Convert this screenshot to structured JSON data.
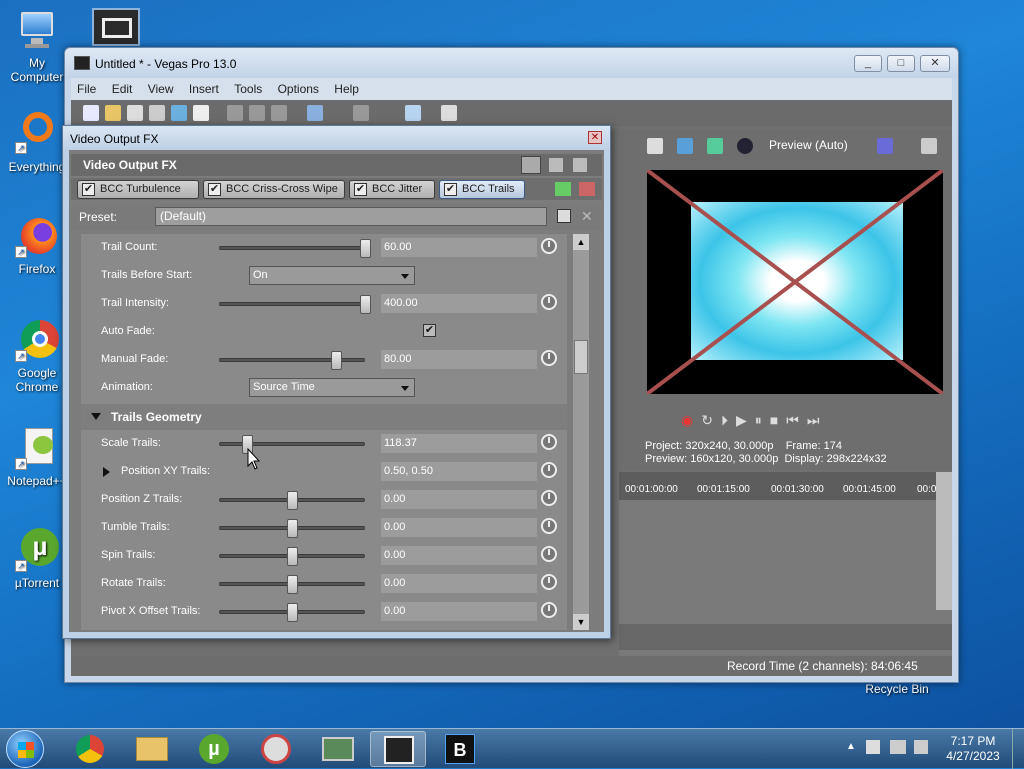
{
  "desktop": {
    "icons": [
      {
        "label": "My Computer",
        "name": "my-computer"
      },
      {
        "label": "Everything",
        "name": "everything"
      },
      {
        "label": "Firefox",
        "name": "firefox"
      },
      {
        "label": "Google Chrome",
        "name": "google-chrome"
      },
      {
        "label": "Notepad++",
        "name": "notepad-plus-plus"
      },
      {
        "label": "µTorrent",
        "name": "utorrent"
      }
    ],
    "recycle_bin": "Recycle Bin"
  },
  "vegas": {
    "title": "Untitled * - Vegas Pro 13.0",
    "menu": [
      "File",
      "Edit",
      "View",
      "Insert",
      "Tools",
      "Options",
      "Help"
    ],
    "preview_mode": "Preview (Auto)",
    "info": {
      "project_label": "Project:",
      "project": "320x240, 30.000p",
      "frame_label": "Frame:",
      "frame": "174",
      "preview_label": "Preview:",
      "preview": "160x120, 30.000p",
      "display_label": "Display:",
      "display": "298x224x32"
    },
    "timecodes": [
      "00:01:00:00",
      "00:01:15:00",
      "00:01:30:00",
      "00:01:45:00",
      "00:0"
    ],
    "record_time": "Record Time (2 channels): 84:06:45"
  },
  "fx_dialog": {
    "title": "Video Output FX",
    "header": "Video Output FX",
    "plugins": [
      "BCC Turbulence",
      "BCC Criss-Cross Wipe",
      "BCC Jitter",
      "BCC Trails"
    ],
    "preset_label": "Preset:",
    "preset_value": "(Default)",
    "params": {
      "trail_count": {
        "label": "Trail Count:",
        "value": "60.00"
      },
      "trails_before_start": {
        "label": "Trails Before Start:",
        "value": "On"
      },
      "trail_intensity": {
        "label": "Trail Intensity:",
        "value": "400.00"
      },
      "auto_fade": {
        "label": "Auto Fade:"
      },
      "manual_fade": {
        "label": "Manual Fade:",
        "value": "80.00"
      },
      "animation": {
        "label": "Animation:",
        "value": "Source Time"
      }
    },
    "section_title": "Trails Geometry",
    "geometry": {
      "scale_trails": {
        "label": "Scale Trails:",
        "value": "118.37"
      },
      "position_xy": {
        "label": "Position XY Trails:",
        "value": "0.50, 0.50"
      },
      "position_z": {
        "label": "Position Z Trails:",
        "value": "0.00"
      },
      "tumble": {
        "label": "Tumble Trails:",
        "value": "0.00"
      },
      "spin": {
        "label": "Spin Trails:",
        "value": "0.00"
      },
      "rotate": {
        "label": "Rotate Trails:",
        "value": "0.00"
      },
      "pivot_x": {
        "label": "Pivot X Offset Trails:",
        "value": "0.00"
      }
    }
  },
  "taskbar": {
    "time": "7:17 PM",
    "date": "4/27/2023"
  }
}
